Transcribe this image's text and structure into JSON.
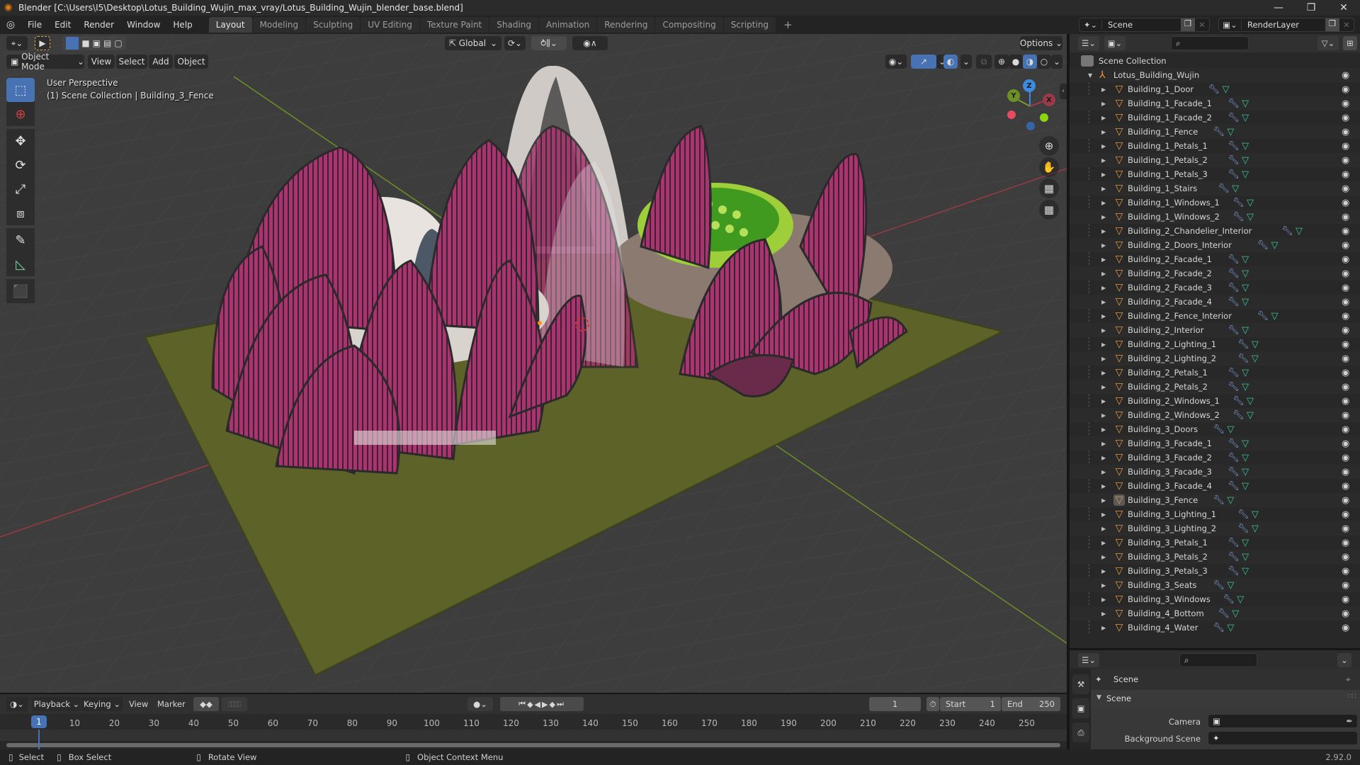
{
  "window": {
    "title": "Blender [C:\\Users\\I5\\Desktop\\Lotus_Building_Wujin_max_vray/Lotus_Building_Wujin_blender_base.blend]",
    "controls": [
      "minimize",
      "maximize",
      "close"
    ]
  },
  "menu": [
    "File",
    "Edit",
    "Render",
    "Window",
    "Help"
  ],
  "workspaces": {
    "tabs": [
      "Layout",
      "Modeling",
      "Sculpting",
      "UV Editing",
      "Texture Paint",
      "Shading",
      "Animation",
      "Rendering",
      "Compositing",
      "Scripting"
    ],
    "active": "Layout",
    "add_label": "+"
  },
  "scene_selector": {
    "value": "Scene"
  },
  "view_layer_selector": {
    "value": "RenderLayer"
  },
  "viewport": {
    "transform_orientation": "Global",
    "options_label": "Options",
    "mode": "Object Mode",
    "menus": [
      "View",
      "Select",
      "Add",
      "Object"
    ],
    "overlay_line1": "User Perspective",
    "overlay_line2": "(1) Scene Collection | Building_3_Fence",
    "gizmo_axes": {
      "x": "X",
      "y": "Y",
      "z": "Z"
    },
    "shading_active": "material-preview",
    "colors": {
      "background": "#3d3d3d",
      "grid": "#4a4a4a",
      "x_axis": "#9a3a43",
      "y_axis": "#6e8f25",
      "petal": "#a02f6e",
      "ground": "#5c6228"
    }
  },
  "toolbar": {
    "tools": [
      "select-box",
      "cursor",
      "move",
      "rotate",
      "scale",
      "transform",
      "annotate",
      "measure",
      "add-cube"
    ],
    "active": "select-box"
  },
  "outliner": {
    "root": "Scene Collection",
    "collection": "Lotus_Building_Wujin",
    "selected": "Building_3_Fence",
    "items": [
      "Building_1_Door",
      "Building_1_Facade_1",
      "Building_1_Facade_2",
      "Building_1_Fence",
      "Building_1_Petals_1",
      "Building_1_Petals_2",
      "Building_1_Petals_3",
      "Building_1_Stairs",
      "Building_1_Windows_1",
      "Building_1_Windows_2",
      "Building_2_Chandelier_Interior",
      "Building_2_Doors_Interior",
      "Building_2_Facade_1",
      "Building_2_Facade_2",
      "Building_2_Facade_3",
      "Building_2_Facade_4",
      "Building_2_Fence_Interior",
      "Building_2_Interior",
      "Building_2_Lighting_1",
      "Building_2_Lighting_2",
      "Building_2_Petals_1",
      "Building_2_Petals_2",
      "Building_2_Windows_1",
      "Building_2_Windows_2",
      "Building_3_Doors",
      "Building_3_Facade_1",
      "Building_3_Facade_2",
      "Building_3_Facade_3",
      "Building_3_Facade_4",
      "Building_3_Fence",
      "Building_3_Lighting_1",
      "Building_3_Lighting_2",
      "Building_3_Petals_1",
      "Building_3_Petals_2",
      "Building_3_Petals_3",
      "Building_3_Seats",
      "Building_3_Windows",
      "Building_4_Bottom",
      "Building_4_Water"
    ]
  },
  "properties": {
    "context_title": "Scene",
    "panel_title": "Scene",
    "camera_label": "Camera",
    "camera_value": "",
    "background_scene_label": "Background Scene",
    "background_scene_value": ""
  },
  "timeline": {
    "menus": [
      "Playback",
      "Keying",
      "View",
      "Marker"
    ],
    "current_frame": "1",
    "start_label": "Start",
    "start": "1",
    "end_label": "End",
    "end": "250",
    "ticks": [
      "10",
      "20",
      "30",
      "40",
      "50",
      "60",
      "70",
      "80",
      "90",
      "100",
      "110",
      "120",
      "130",
      "140",
      "150",
      "160",
      "170",
      "180",
      "190",
      "200",
      "210",
      "220",
      "230",
      "240",
      "250"
    ],
    "playhead": "1"
  },
  "statusbar": {
    "select": "Select",
    "box_select": "Box Select",
    "rotate_view": "Rotate View",
    "context_menu": "Object Context Menu",
    "version": "2.92.0"
  }
}
